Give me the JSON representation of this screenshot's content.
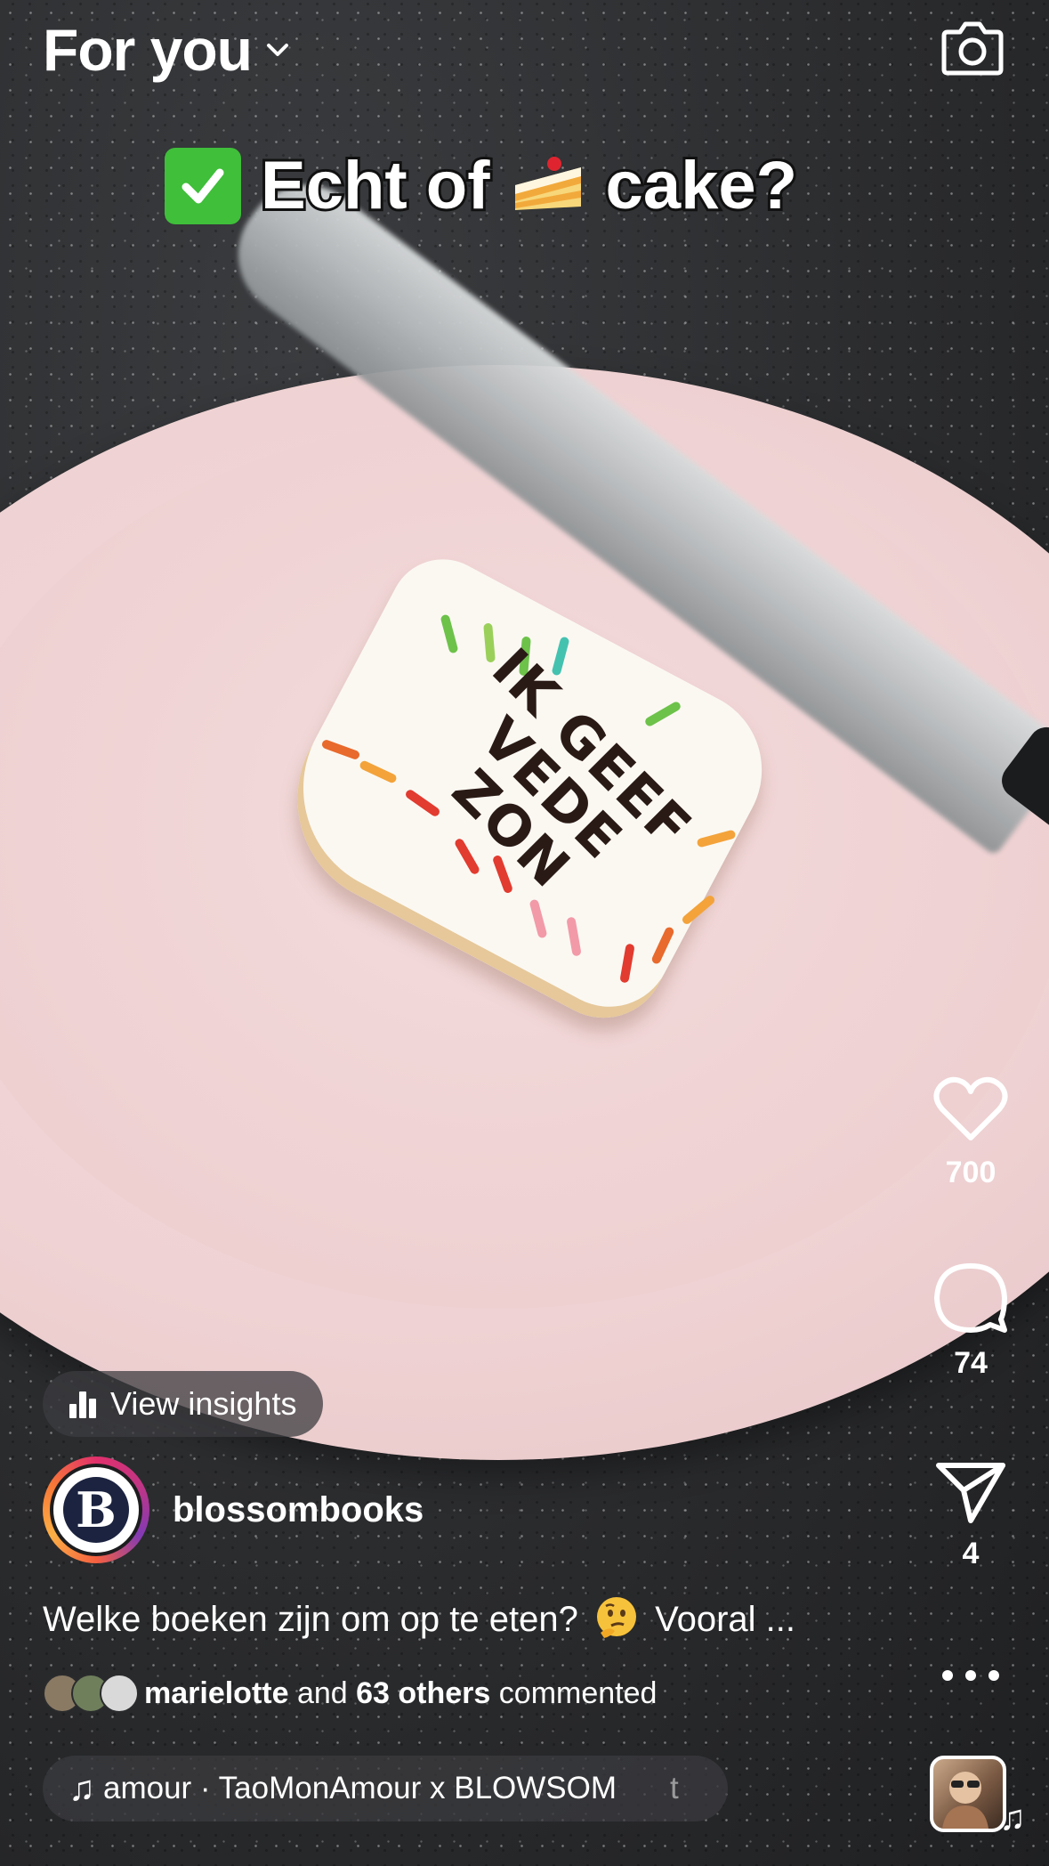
{
  "header": {
    "title": "For you",
    "camera_icon": "camera-icon"
  },
  "overlay": {
    "caption_part1": "Echt of",
    "caption_part2": "cake?",
    "check_emoji": "✔",
    "cake_emoji": "cake-slice"
  },
  "video_scene": {
    "cake_text": "IK GEEF VEDE ZON"
  },
  "actions": {
    "likes": "700",
    "comments": "74",
    "shares": "4"
  },
  "insights": {
    "label": "View insights"
  },
  "author": {
    "username": "blossombooks",
    "avatar_letter": "B"
  },
  "post": {
    "caption_before": "Welke boeken zijn om op te eten?",
    "caption_after": "Vooral ...",
    "caption_emoji": "thinking-face"
  },
  "comments_summary": {
    "first_name": "marielotte",
    "middle": "and",
    "others": "63 others",
    "suffix": "commented"
  },
  "audio": {
    "track": "amour · TaoMonAmour x BLOWSOM",
    "tail": "t"
  },
  "colors": {
    "ring_start": "#e1306c",
    "ring_end": "#fcaf45",
    "pill_bg": "rgba(60,60,64,0.75)"
  }
}
